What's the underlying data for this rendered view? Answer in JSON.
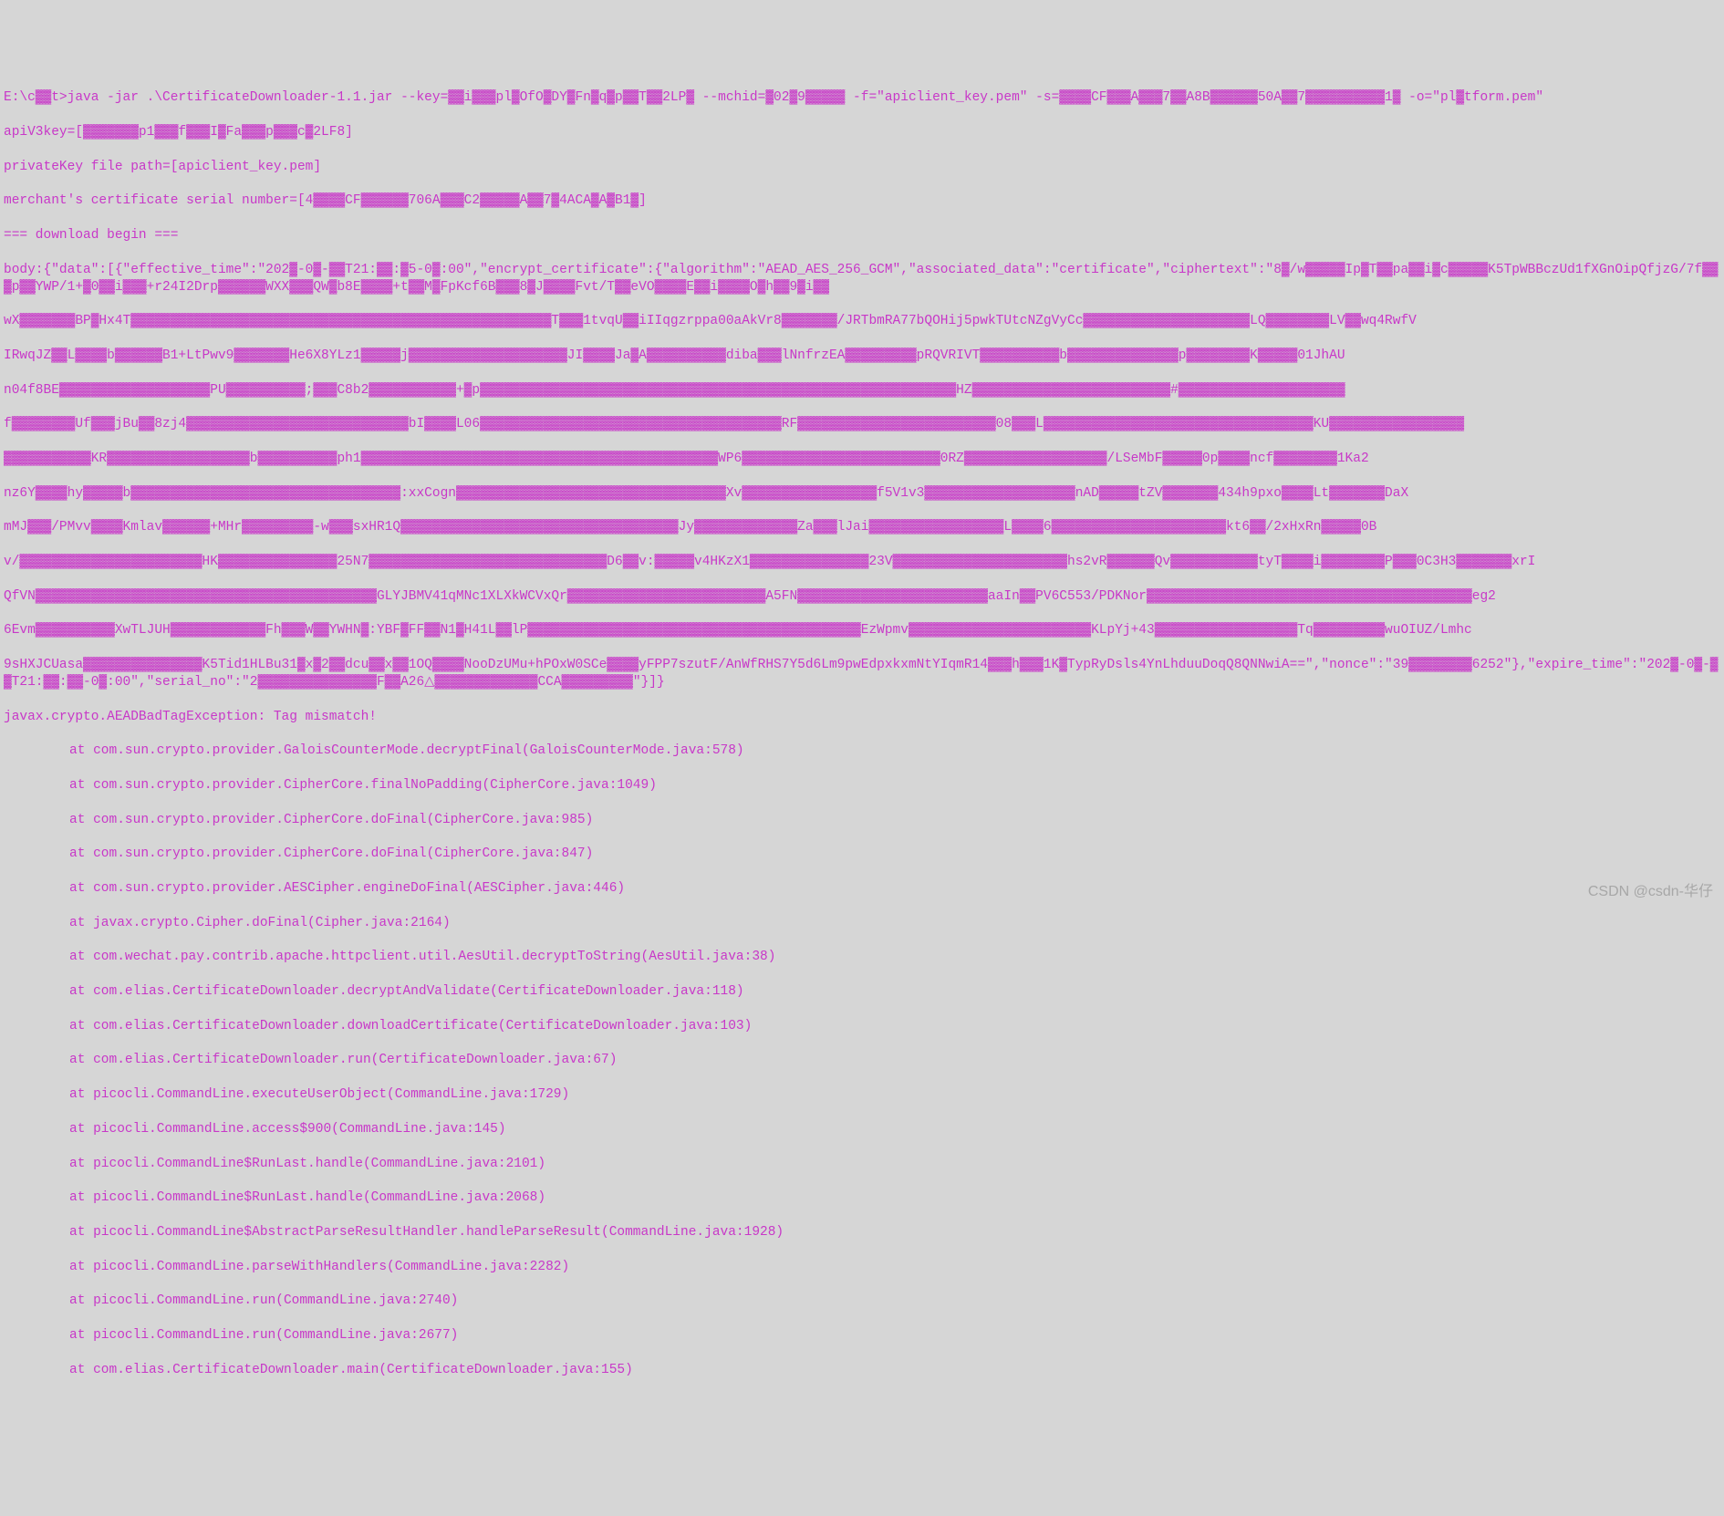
{
  "terminal": {
    "command_line": "E:\\c▓▓t>java -jar .\\CertificateDownloader-1.1.jar --key=▓▓i▓▓▓pl▓OfO▓DY▓Fn▓q▓p▓▓T▓▓2LP▓ --mchid=▓02▓9▓▓▓▓▓ -f=\"apiclient_key.pem\" -s=▓▓▓▓CF▓▓▓A▓▓▓7▓▓A8B▓▓▓▓▓▓50A▓▓7▓▓▓▓▓▓▓▓▓▓1▓ -o=\"pl▓tform.pem\"",
    "apiv3key": "apiV3key=[▓▓▓▓▓▓▓p1▓▓▓f▓▓▓I▓Fa▓▓▓p▓▓▓c▓2LF8]",
    "private_key": "privateKey file path=[apiclient_key.pem]",
    "merchant_cert": "merchant's certificate serial number=[4▓▓▓▓CF▓▓▓▓▓▓706A▓▓▓C2▓▓▓▓▓A▓▓7▓4ACA▓A▓B1▓]",
    "download_begin": "=== download begin ===",
    "body_start": "body:{\"data\":[{\"effective_time\":\"202▓-0▓-▓▓T21:▓▓:▓5-0▓:00\",\"encrypt_certificate\":{\"algorithm\":\"AEAD_AES_256_GCM\",\"associated_data\":\"certificate\",\"ciphertext\":\"8▓/w▓▓▓▓▓Ip▓T▓▓pa▓▓i▓c▓▓▓▓▓K5TpWBBczUd1fXGnOipQfjzG/7f▓▓▓p▓▓YWP/1+▓0▓▓i▓▓▓+r24I2Drp▓▓▓▓▓▓WXX▓▓▓QW▓b8E▓▓▓▓+t▓▓M▓FpKcf6B▓▓▓8▓J▓▓▓▓Fvt/T▓▓eVO▓▓▓▓E▓▓i▓▓▓▓O▓h▓▓9▓i▓▓",
    "body_blur_1": "wX▓▓▓▓▓▓▓BP▓Hx4T▓▓▓▓▓▓▓▓▓▓▓▓▓▓▓▓▓▓▓▓▓▓▓▓▓▓▓▓▓▓▓▓▓▓▓▓▓▓▓▓▓▓▓▓▓▓▓▓▓▓▓▓▓T▓▓▓1tvqU▓▓iIIqgzrppa00aAkVr8▓▓▓▓▓▓▓/JRTbmRA77bQOHij5pwkTUtcNZgVyCc▓▓▓▓▓▓▓▓▓▓▓▓▓▓▓▓▓▓▓▓▓LQ▓▓▓▓▓▓▓▓LV▓▓wq4RwfV",
    "body_blur_2": "IRwqJZ▓▓L▓▓▓▓b▓▓▓▓▓▓B1+LtPwv9▓▓▓▓▓▓▓He6X8YLz1▓▓▓▓▓j▓▓▓▓▓▓▓▓▓▓▓▓▓▓▓▓▓▓▓▓JI▓▓▓▓Ja▓A▓▓▓▓▓▓▓▓▓▓diba▓▓▓lNnfrzEA▓▓▓▓▓▓▓▓▓pRQVRIVT▓▓▓▓▓▓▓▓▓▓b▓▓▓▓▓▓▓▓▓▓▓▓▓▓p▓▓▓▓▓▓▓▓K▓▓▓▓▓01JhAU",
    "body_blur_3": "n04f8BE▓▓▓▓▓▓▓▓▓▓▓▓▓▓▓▓▓▓▓PU▓▓▓▓▓▓▓▓▓▓;▓▓▓C8b2▓▓▓▓▓▓▓▓▓▓▓+▓p▓▓▓▓▓▓▓▓▓▓▓▓▓▓▓▓▓▓▓▓▓▓▓▓▓▓▓▓▓▓▓▓▓▓▓▓▓▓▓▓▓▓▓▓▓▓▓▓▓▓▓▓▓▓▓▓▓▓▓▓HZ▓▓▓▓▓▓▓▓▓▓▓▓▓▓▓▓▓▓▓▓▓▓▓▓▓#▓▓▓▓▓▓▓▓▓▓▓▓▓▓▓▓▓▓▓▓▓",
    "body_blur_4": "f▓▓▓▓▓▓▓▓Uf▓▓▓jBu▓▓8zj4▓▓▓▓▓▓▓▓▓▓▓▓▓▓▓▓▓▓▓▓▓▓▓▓▓▓▓▓bI▓▓▓▓L06▓▓▓▓▓▓▓▓▓▓▓▓▓▓▓▓▓▓▓▓▓▓▓▓▓▓▓▓▓▓▓▓▓▓▓▓▓▓RF▓▓▓▓▓▓▓▓▓▓▓▓▓▓▓▓▓▓▓▓▓▓▓▓▓08▓▓▓L▓▓▓▓▓▓▓▓▓▓▓▓▓▓▓▓▓▓▓▓▓▓▓▓▓▓▓▓▓▓▓▓▓▓KU▓▓▓▓▓▓▓▓▓▓▓▓▓▓▓▓▓",
    "body_blur_5": "▓▓▓▓▓▓▓▓▓▓▓KR▓▓▓▓▓▓▓▓▓▓▓▓▓▓▓▓▓▓b▓▓▓▓▓▓▓▓▓▓ph1▓▓▓▓▓▓▓▓▓▓▓▓▓▓▓▓▓▓▓▓▓▓▓▓▓▓▓▓▓▓▓▓▓▓▓▓▓▓▓▓▓▓▓▓▓WP6▓▓▓▓▓▓▓▓▓▓▓▓▓▓▓▓▓▓▓▓▓▓▓▓▓0RZ▓▓▓▓▓▓▓▓▓▓▓▓▓▓▓▓▓▓/LSeMbF▓▓▓▓▓0p▓▓▓▓ncf▓▓▓▓▓▓▓▓1Ka2",
    "body_blur_6": "nz6Y▓▓▓▓hy▓▓▓▓▓b▓▓▓▓▓▓▓▓▓▓▓▓▓▓▓▓▓▓▓▓▓▓▓▓▓▓▓▓▓▓▓▓▓▓:xxCogn▓▓▓▓▓▓▓▓▓▓▓▓▓▓▓▓▓▓▓▓▓▓▓▓▓▓▓▓▓▓▓▓▓▓Xv▓▓▓▓▓▓▓▓▓▓▓▓▓▓▓▓▓f5V1v3▓▓▓▓▓▓▓▓▓▓▓▓▓▓▓▓▓▓▓nAD▓▓▓▓▓tZV▓▓▓▓▓▓▓434h9pxo▓▓▓▓Lt▓▓▓▓▓▓▓DaX",
    "body_blur_7": "mMJ▓▓▓/PMvv▓▓▓▓Kmlav▓▓▓▓▓▓+MHr▓▓▓▓▓▓▓▓▓-w▓▓▓sxHR1Q▓▓▓▓▓▓▓▓▓▓▓▓▓▓▓▓▓▓▓▓▓▓▓▓▓▓▓▓▓▓▓▓▓▓▓Jy▓▓▓▓▓▓▓▓▓▓▓▓▓Za▓▓▓lJai▓▓▓▓▓▓▓▓▓▓▓▓▓▓▓▓▓L▓▓▓▓6▓▓▓▓▓▓▓▓▓▓▓▓▓▓▓▓▓▓▓▓▓▓kt6▓▓/2xHxRn▓▓▓▓▓0B",
    "body_blur_8": "v/▓▓▓▓▓▓▓▓▓▓▓▓▓▓▓▓▓▓▓▓▓▓▓HK▓▓▓▓▓▓▓▓▓▓▓▓▓▓▓25N7▓▓▓▓▓▓▓▓▓▓▓▓▓▓▓▓▓▓▓▓▓▓▓▓▓▓▓▓▓▓D6▓▓v:▓▓▓▓▓v4HKzX1▓▓▓▓▓▓▓▓▓▓▓▓▓▓▓23V▓▓▓▓▓▓▓▓▓▓▓▓▓▓▓▓▓▓▓▓▓▓hs2vR▓▓▓▓▓▓Qv▓▓▓▓▓▓▓▓▓▓▓tyT▓▓▓▓i▓▓▓▓▓▓▓▓P▓▓▓0C3H3▓▓▓▓▓▓▓xrI",
    "body_blur_9": "QfVN▓▓▓▓▓▓▓▓▓▓▓▓▓▓▓▓▓▓▓▓▓▓▓▓▓▓▓▓▓▓▓▓▓▓▓▓▓▓▓▓▓▓▓GLYJBMV41qMNc1XLXkWCVxQr▓▓▓▓▓▓▓▓▓▓▓▓▓▓▓▓▓▓▓▓▓▓▓▓▓A5FN▓▓▓▓▓▓▓▓▓▓▓▓▓▓▓▓▓▓▓▓▓▓▓▓aaIn▓▓PV6C553/PDKNor▓▓▓▓▓▓▓▓▓▓▓▓▓▓▓▓▓▓▓▓▓▓▓▓▓▓▓▓▓▓▓▓▓▓▓▓▓▓▓▓▓eg2",
    "body_blur_10": "6Evm▓▓▓▓▓▓▓▓▓▓XwTLJUH▓▓▓▓▓▓▓▓▓▓▓▓Fh▓▓▓W▓▓YWHN▓:YBF▓FF▓▓N1▓H41L▓▓lP▓▓▓▓▓▓▓▓▓▓▓▓▓▓▓▓▓▓▓▓▓▓▓▓▓▓▓▓▓▓▓▓▓▓▓▓▓▓▓▓▓▓EzWpmv▓▓▓▓▓▓▓▓▓▓▓▓▓▓▓▓▓▓▓▓▓▓▓KLpYj+43▓▓▓▓▓▓▓▓▓▓▓▓▓▓▓▓▓▓Tq▓▓▓▓▓▓▓▓▓wuOIUZ/Lmhc",
    "body_end": "9sHXJCUasa▓▓▓▓▓▓▓▓▓▓▓▓▓▓▓K5Tid1HLBu31▓x▓2▓▓dcu▓▓x▓▓1OQ▓▓▓▓NooDzUMu+hPOxW0SCe▓▓▓▓yFPP7szutF/AnWfRHS7Y5d6Lm9pwEdpxkxmNtYIqmR14▓▓▓h▓▓▓1K▓TypRyDsls4YnLhduuDoqQ8QNNwiA==\",\"nonce\":\"39▓▓▓▓▓▓▓▓6252\"},\"expire_time\":\"202▓-0▓-▓▓T21:▓▓:▓▓-0▓:00\",\"serial_no\":\"2▓▓▓▓▓▓▓▓▓▓▓▓▓▓▓F▓▓A26△▓▓▓▓▓▓▓▓▓▓▓▓▓CCA▓▓▓▓▓▓▓▓▓\"}]}",
    "exception": "javax.crypto.AEADBadTagException: Tag mismatch!",
    "stack_trace": [
      "at com.sun.crypto.provider.GaloisCounterMode.decryptFinal(GaloisCounterMode.java:578)",
      "at com.sun.crypto.provider.CipherCore.finalNoPadding(CipherCore.java:1049)",
      "at com.sun.crypto.provider.CipherCore.doFinal(CipherCore.java:985)",
      "at com.sun.crypto.provider.CipherCore.doFinal(CipherCore.java:847)",
      "at com.sun.crypto.provider.AESCipher.engineDoFinal(AESCipher.java:446)",
      "at javax.crypto.Cipher.doFinal(Cipher.java:2164)",
      "at com.wechat.pay.contrib.apache.httpclient.util.AesUtil.decryptToString(AesUtil.java:38)",
      "at com.elias.CertificateDownloader.decryptAndValidate(CertificateDownloader.java:118)",
      "at com.elias.CertificateDownloader.downloadCertificate(CertificateDownloader.java:103)",
      "at com.elias.CertificateDownloader.run(CertificateDownloader.java:67)",
      "at picocli.CommandLine.executeUserObject(CommandLine.java:1729)",
      "at picocli.CommandLine.access$900(CommandLine.java:145)",
      "at picocli.CommandLine$RunLast.handle(CommandLine.java:2101)",
      "at picocli.CommandLine$RunLast.handle(CommandLine.java:2068)",
      "at picocli.CommandLine$AbstractParseResultHandler.handleParseResult(CommandLine.java:1928)",
      "at picocli.CommandLine.parseWithHandlers(CommandLine.java:2282)",
      "at picocli.CommandLine.run(CommandLine.java:2740)",
      "at picocli.CommandLine.run(CommandLine.java:2677)",
      "at com.elias.CertificateDownloader.main(CertificateDownloader.java:155)"
    ]
  },
  "watermark": "CSDN @csdn-华仔"
}
